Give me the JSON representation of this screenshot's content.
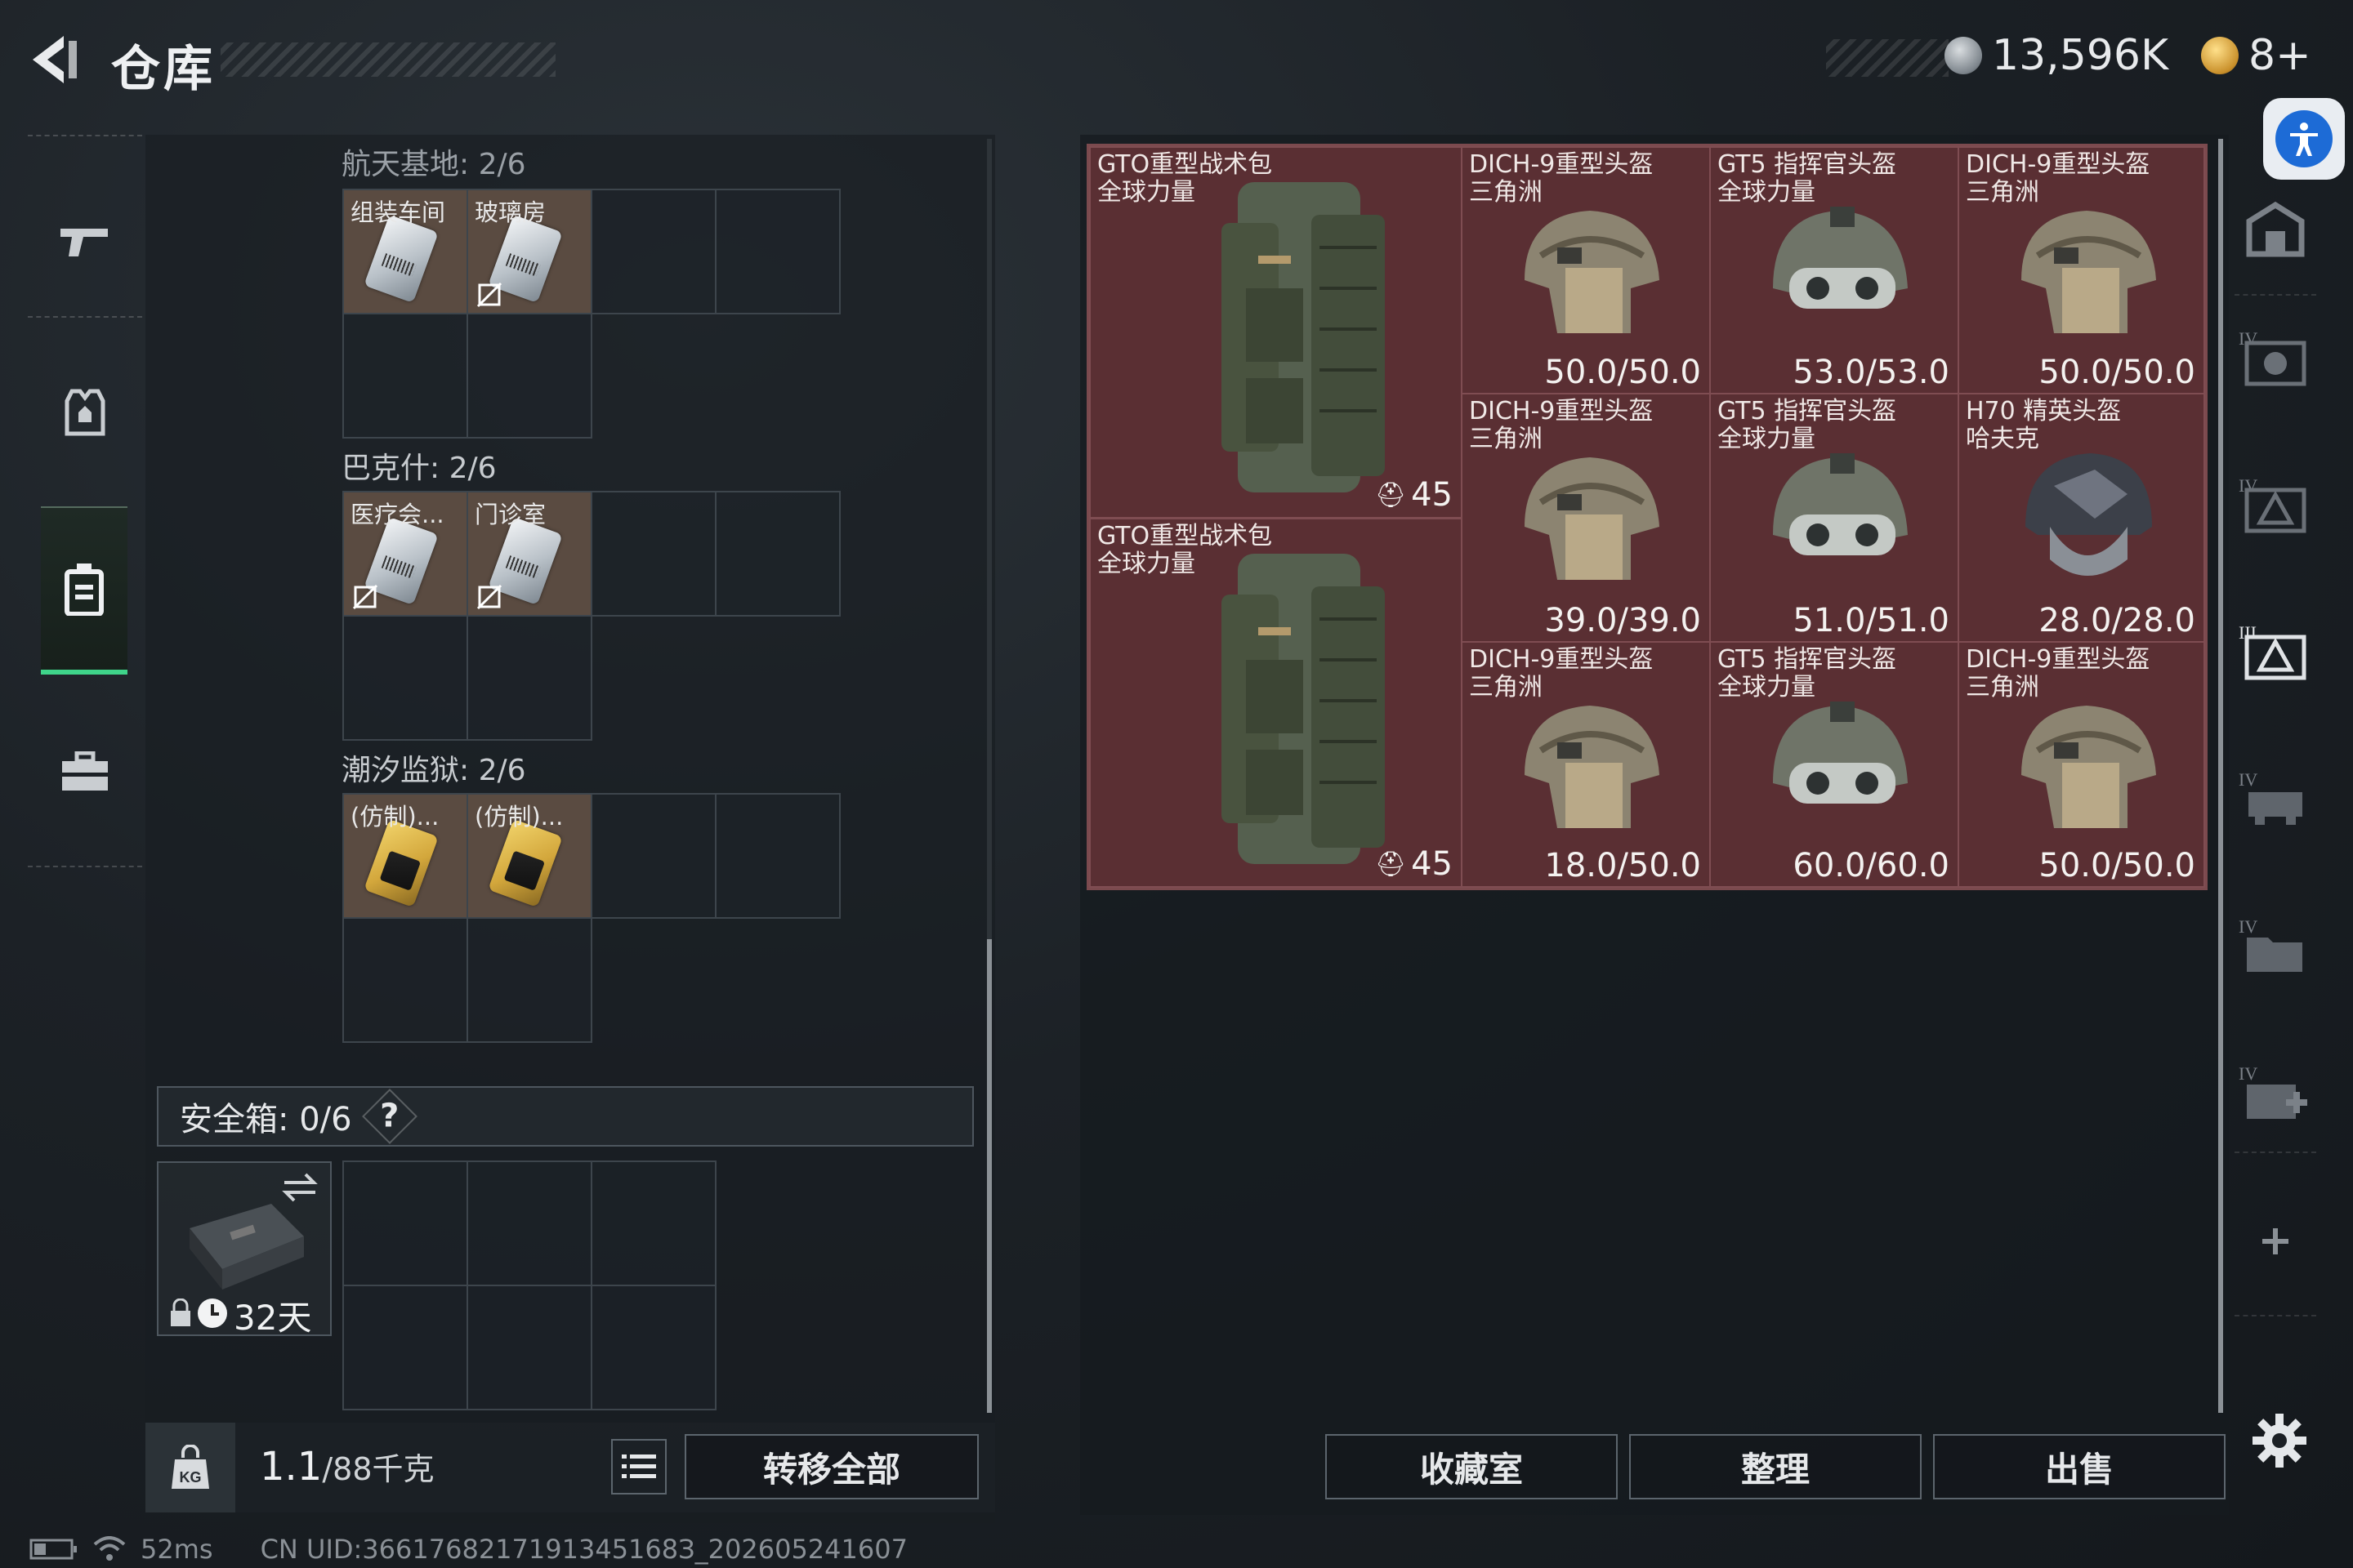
{
  "header": {
    "title": "仓库",
    "currency": {
      "value": "13,596K"
    },
    "tickets": {
      "value": "8+"
    }
  },
  "colors": {
    "accent_green": "#3fd48a",
    "item_red": "#5a2f33",
    "item_brown": "#5a4b41"
  },
  "left_nav": [
    {
      "name": "weapon-tab",
      "icon": "gun-icon"
    },
    {
      "name": "armor-tab",
      "icon": "vest-icon"
    },
    {
      "name": "backpack-tab",
      "icon": "backpack-icon",
      "active": true
    },
    {
      "name": "toolbox-tab",
      "icon": "toolbox-icon"
    }
  ],
  "containers": {
    "sections": [
      {
        "label": "航天基地: 2/6",
        "items": [
          {
            "tag": "组装车间",
            "type": "card"
          },
          {
            "tag": "玻璃房",
            "type": "card",
            "locked": true
          }
        ]
      },
      {
        "label": "巴克什: 2/6",
        "items": [
          {
            "tag": "医疗会...",
            "type": "card",
            "locked": true
          },
          {
            "tag": "门诊室",
            "type": "card",
            "locked": true
          }
        ]
      },
      {
        "label": "潮汐监狱: 2/6",
        "items": [
          {
            "tag": "(仿制)...",
            "type": "gold"
          },
          {
            "tag": "(仿制)...",
            "type": "gold"
          }
        ]
      }
    ],
    "safe_box": {
      "label": "安全箱: 0/6",
      "help": "?",
      "timer": "32天"
    },
    "weight": {
      "value": "1.1",
      "max": "/88千克"
    },
    "transfer_all": "转移全部"
  },
  "stash": {
    "items": [
      {
        "name_line1": "GTO重型战术包",
        "name_line2": "全球力量",
        "capacity": "45",
        "kind": "backpack"
      },
      {
        "name_line1": "DICH-9重型头盔",
        "name_line2": "三角洲",
        "durability": "50.0/50.0",
        "kind": "helmet-tan"
      },
      {
        "name_line1": "GT5 指挥官头盔",
        "name_line2": "全球力量",
        "durability": "53.0/53.0",
        "kind": "helmet-goggle"
      },
      {
        "name_line1": "DICH-9重型头盔",
        "name_line2": "三角洲",
        "durability": "50.0/50.0",
        "kind": "helmet-tan"
      },
      {
        "name_line1": "DICH-9重型头盔",
        "name_line2": "三角洲",
        "durability": "39.0/39.0",
        "kind": "helmet-tan"
      },
      {
        "name_line1": "GT5 指挥官头盔",
        "name_line2": "全球力量",
        "durability": "51.0/51.0",
        "kind": "helmet-goggle"
      },
      {
        "name_line1": "H70 精英头盔",
        "name_line2": "哈夫克",
        "durability": "28.0/28.0",
        "kind": "helmet-dark"
      },
      {
        "name_line1": "GTO重型战术包",
        "name_line2": "全球力量",
        "capacity": "45",
        "kind": "backpack"
      },
      {
        "name_line1": "DICH-9重型头盔",
        "name_line2": "三角洲",
        "durability": "18.0/50.0",
        "kind": "helmet-tan"
      },
      {
        "name_line1": "GT5 指挥官头盔",
        "name_line2": "全球力量",
        "durability": "60.0/60.0",
        "kind": "helmet-goggle"
      },
      {
        "name_line1": "DICH-9重型头盔",
        "name_line2": "三角洲",
        "durability": "50.0/50.0",
        "kind": "helmet-tan"
      }
    ],
    "buttons": {
      "collection": "收藏室",
      "sort": "整理",
      "sell": "出售"
    }
  },
  "right_nav": [
    "home-icon",
    "tier4-helmet-icon",
    "tier4-armor-icon",
    "tier3-armor-icon",
    "tier4-vehicle-icon",
    "tier4-folder-icon",
    "tier4-medkit-icon",
    "plus-icon"
  ],
  "status": {
    "ping": "52ms",
    "uid": "CN UID:3661768217191345168З_202605241607"
  }
}
